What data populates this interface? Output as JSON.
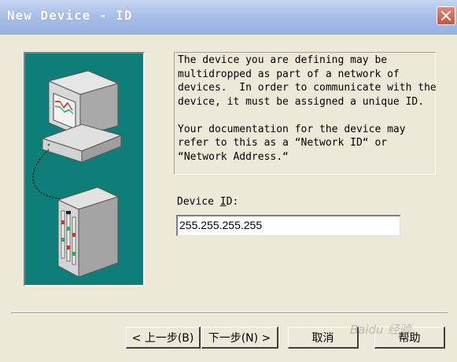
{
  "window": {
    "title": "New Device - ID"
  },
  "description": {
    "paragraph1": "The device you are defining may be\nmultidropped as part of a network of\ndevices.  In order to communicate with the\ndevice, it must be assigned a unique ID.",
    "paragraph2": "Your documentation for the device may\nrefer to this as a “Network ID“ or\n“Network Address.“"
  },
  "device_id": {
    "label_pre": "Device ",
    "label_key": "I",
    "label_post": "D:",
    "value": "255.255.255.255"
  },
  "buttons": {
    "back": "< 上一步(B)",
    "next": "下一步(N) >",
    "cancel": "取消",
    "help": "帮助"
  },
  "watermark": "Baidu 经验",
  "colors": {
    "panel_bg": "#0e7e78",
    "dialog_bg": "#ece9d8",
    "titlebar": "#a9bfe8"
  }
}
